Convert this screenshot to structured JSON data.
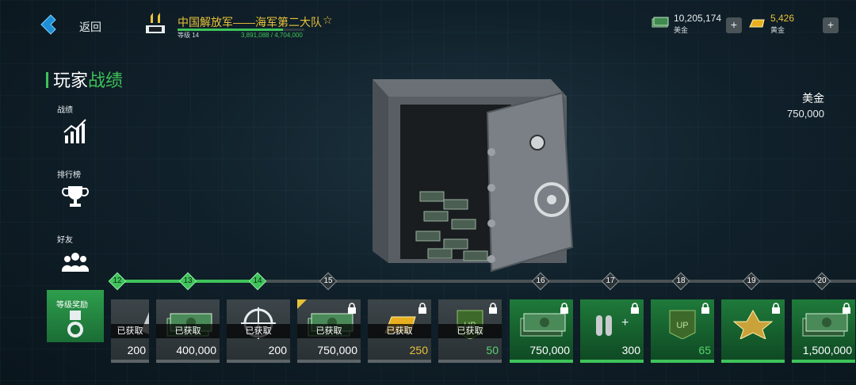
{
  "header": {
    "back_label": "返回",
    "player_name": "中国解放军——海军第二大队",
    "level_label": "等级 14",
    "xp_text": "3,891,088 / 4,704,000",
    "xp_progress": 0.83,
    "currencies": [
      {
        "value": "10,205,174",
        "name": "美金",
        "icon": "cash-icon"
      },
      {
        "value": "5,426",
        "name": "黄金",
        "icon": "gold-bar-icon"
      }
    ],
    "plus_label": "+"
  },
  "sidebar": {
    "title_plain": "玩家",
    "title_highlight": "战绩",
    "items": [
      {
        "label": "战绩",
        "icon": "stats-chart-icon"
      },
      {
        "label": "排行榜",
        "icon": "trophy-icon"
      },
      {
        "label": "好友",
        "icon": "friends-icon"
      },
      {
        "label": "等级奖励",
        "icon": "medal-icon"
      }
    ]
  },
  "detail": {
    "reward_name": "美金",
    "reward_amount": "750,000"
  },
  "track": {
    "levels": [
      "12",
      "13",
      "14",
      "15",
      "16",
      "17",
      "18",
      "19",
      "20"
    ],
    "completed_through": "14"
  },
  "rewards": [
    {
      "status": "已获取",
      "amount": "200",
      "type": "partial"
    },
    {
      "status": "已获取",
      "amount": "400,000",
      "type": "cash"
    },
    {
      "status": "已获取",
      "amount": "200",
      "type": "scope"
    },
    {
      "status": "已获取",
      "amount": "750,000",
      "type": "cash"
    },
    {
      "status": "已获取",
      "amount": "250",
      "type": "gold"
    },
    {
      "status": "已获取",
      "amount": "50",
      "type": "armor"
    },
    {
      "amount": "750,000",
      "type": "cash"
    },
    {
      "amount": "300",
      "type": "ammo"
    },
    {
      "amount": "65",
      "type": "armor"
    },
    {
      "amount": "",
      "type": "emblem"
    },
    {
      "amount": "1,500,000",
      "type": "cash"
    }
  ],
  "colors": {
    "accent_green": "#3ec35a",
    "gold": "#e8c23a"
  }
}
